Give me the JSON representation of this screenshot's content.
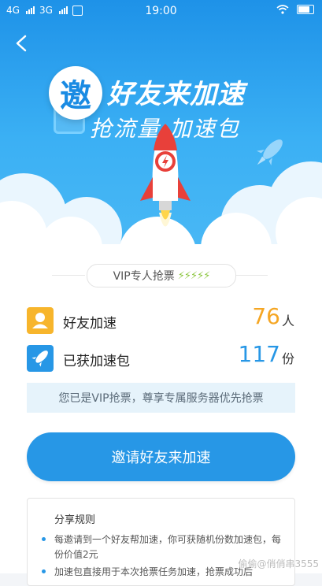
{
  "status": {
    "net1": "4G",
    "net2": "3G",
    "time": "19:00"
  },
  "hero": {
    "badge": "邀",
    "title": "好友来加速",
    "subtitle": "抢流量 加速包"
  },
  "vip": {
    "label": "VIP专人抢票",
    "bolts": "⚡⚡⚡⚡⚡"
  },
  "stats": {
    "friends": {
      "label": "好友加速",
      "value": "76",
      "unit": "人",
      "color": "#f5a623"
    },
    "packages": {
      "label": "已获加速包",
      "value": "117",
      "unit": "份",
      "color": "#2797e6"
    }
  },
  "notice": "您已是VIP抢票，尊享专属服务器优先抢票",
  "invite_button": "邀请好友来加速",
  "rules": {
    "title": "分享规则",
    "items": [
      "每邀请到一个好友帮加速，你可获随机份数加速包，每份价值2元",
      "加速包直接用于本次抢票任务加速，抢票成功后"
    ]
  },
  "watermark": "偷偷@俏俏串3555"
}
